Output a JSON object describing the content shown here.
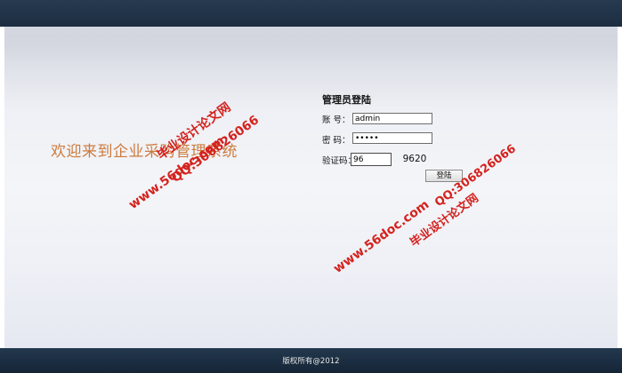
{
  "page": {
    "welcome": "欢迎来到企业采购管理系统",
    "footer": "版权所有@2012"
  },
  "login": {
    "title": "管理员登陆",
    "account_label": "账  号：",
    "password_label": "密  码：",
    "captcha_label": "验证码：",
    "account_value": "admin",
    "password_value": "•••••",
    "captcha_value": "96",
    "captcha_code": "9620",
    "submit_label": "登陆"
  },
  "watermarks": [
    "毕业设计论文网",
    "www.56doc.com",
    "QQ:306826066",
    "毕业设计论文网",
    "www.56doc.com",
    "QQ:306826066"
  ],
  "colors": {
    "welcome": "#cd7a3c",
    "watermark": "#d4221e",
    "bar": "#1c2d40"
  }
}
